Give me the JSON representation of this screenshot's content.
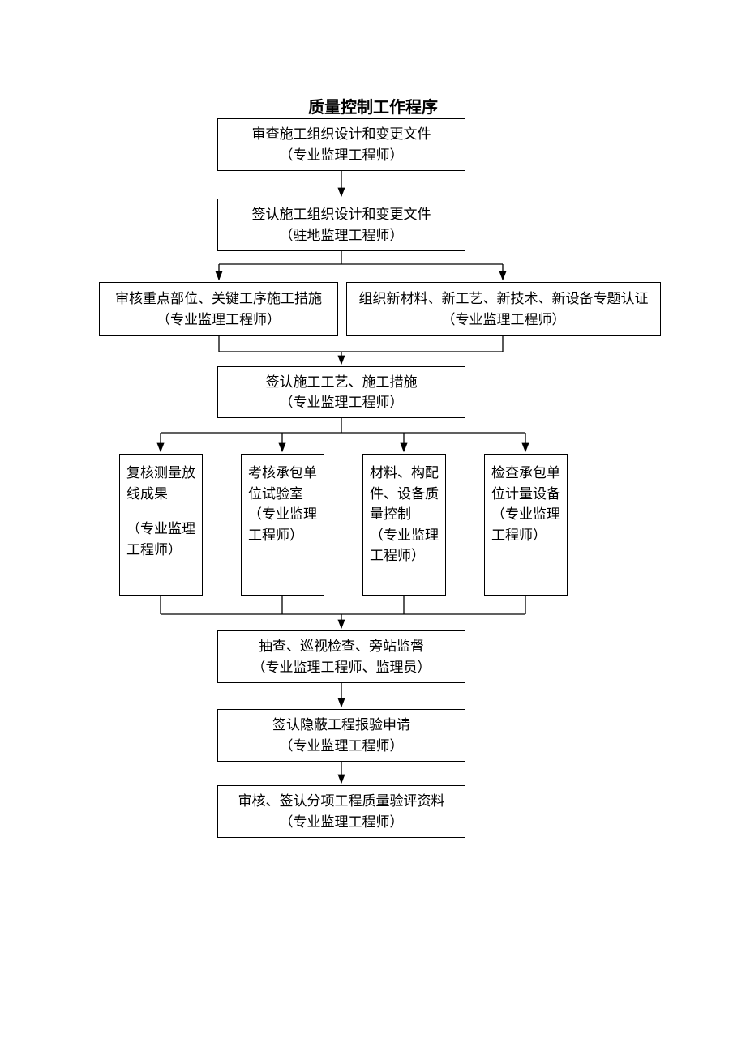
{
  "title": "质量控制工作程序",
  "nodes": {
    "n1": {
      "line1": "审查施工组织设计和变更文件",
      "line2": "（专业监理工程师）"
    },
    "n2": {
      "line1": "签认施工组织设计和变更文件",
      "line2": "（驻地监理工程师）"
    },
    "n3": {
      "line1": "审核重点部位、关键工序施工措施",
      "line2": "（专业监理工程师）"
    },
    "n4": {
      "line1": "组织新材料、新工艺、新技术、新设备专题认证",
      "line2": "（专业监理工程师）"
    },
    "n5": {
      "line1": "签认施工工艺、施工措施",
      "line2": "（专业监理工程师）"
    },
    "c1": {
      "line1": "复核测量放线成果",
      "role": "（专业监理工程师）"
    },
    "c2": {
      "line1": "考核承包单位试验室",
      "role": "（专业监理工程师）"
    },
    "c3": {
      "line1": "材料、构配件、设备质量控制",
      "role": "（专业监理工程师）"
    },
    "c4": {
      "line1": "检查承包单位计量设备",
      "role": "（专业监理工程师）"
    },
    "n6": {
      "line1": "抽查、巡视检查、旁站监督",
      "line2": "（专业监理工程师、监理员）"
    },
    "n7": {
      "line1": "签认隐蔽工程报验申请",
      "line2": "（专业监理工程师）"
    },
    "n8": {
      "line1": "审核、签认分项工程质量验评资料",
      "line2": "（专业监理工程师）"
    }
  }
}
